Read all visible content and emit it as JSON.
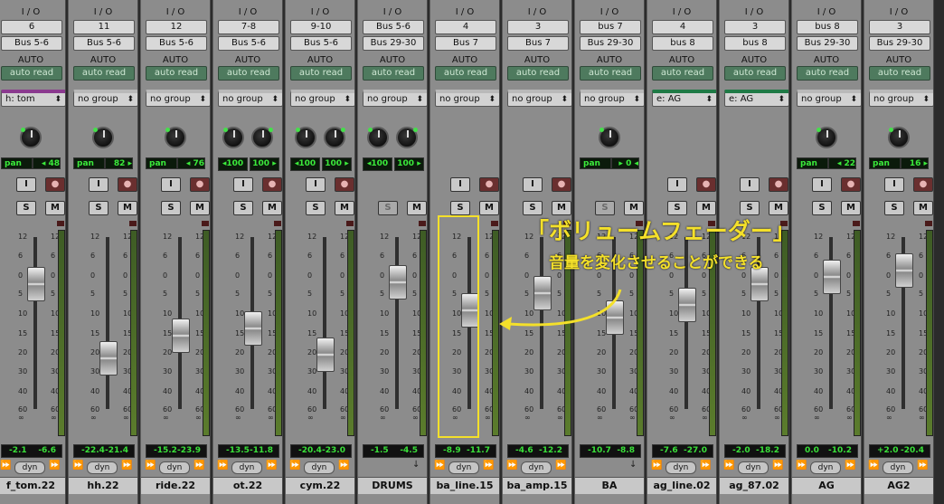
{
  "strips": [
    {
      "io": "I / O",
      "input": "6",
      "output": "Bus 5-6",
      "auto": "AUTO",
      "auto_mode": "auto read",
      "group": "h: tom",
      "group_color": "#8b3a8f",
      "knobs": 1,
      "pan": [
        "pan",
        "◂ 48"
      ],
      "vol": "-2.1",
      "peak": "-6.6",
      "name": "f_tom.22",
      "fader_db": -2.1
    },
    {
      "io": "I / O",
      "input": "11",
      "output": "Bus 5-6",
      "auto": "AUTO",
      "auto_mode": "auto read",
      "group": "no group",
      "group_color": "#b9b9b9",
      "knobs": 1,
      "pan": [
        "pan",
        "82 ▸"
      ],
      "vol": "-22.4",
      "peak": "-21.4",
      "name": "hh.22",
      "fader_db": -22.4
    },
    {
      "io": "I / O",
      "input": "12",
      "output": "Bus 5-6",
      "auto": "AUTO",
      "auto_mode": "auto read",
      "group": "no group",
      "group_color": "#b9b9b9",
      "knobs": 1,
      "pan": [
        "pan",
        "◂ 76"
      ],
      "vol": "-15.2",
      "peak": "-23.9",
      "name": "ride.22",
      "fader_db": -15.2
    },
    {
      "io": "I / O",
      "input": "7-8",
      "output": "Bus 5-6",
      "auto": "AUTO",
      "auto_mode": "auto read",
      "group": "no group",
      "group_color": "#b9b9b9",
      "knobs": 2,
      "pan": [
        "◂100",
        "100 ▸"
      ],
      "vol": "-13.5",
      "peak": "-11.8",
      "name": "ot.22",
      "fader_db": -13.5
    },
    {
      "io": "I / O",
      "input": "9-10",
      "output": "Bus 5-6",
      "auto": "AUTO",
      "auto_mode": "auto read",
      "group": "no group",
      "group_color": "#b9b9b9",
      "knobs": 2,
      "pan": [
        "◂100",
        "100 ▸"
      ],
      "vol": "-20.4",
      "peak": "-23.0",
      "name": "cym.22",
      "fader_db": -20.4
    },
    {
      "io": "I / O",
      "input": "Bus 5-6",
      "output": "Bus 29-30",
      "auto": "AUTO",
      "auto_mode": "auto read",
      "group": "no group",
      "group_color": "#b9b9b9",
      "knobs": 2,
      "pan": [
        "◂100",
        "100 ▸"
      ],
      "vol": "-1.5",
      "peak": "-4.5",
      "name": "DRUMS",
      "fader_db": -1.5,
      "aux": true
    },
    {
      "io": "I / O",
      "input": "4",
      "output": "Bus 7",
      "auto": "AUTO",
      "auto_mode": "auto read",
      "group": "no group",
      "group_color": "#b9b9b9",
      "knobs": 0,
      "pan": [],
      "vol": "-8.9",
      "peak": "-11.7",
      "name": "ba_line.15",
      "fader_db": -8.9
    },
    {
      "io": "I / O",
      "input": "3",
      "output": "Bus 7",
      "auto": "AUTO",
      "auto_mode": "auto read",
      "group": "no group",
      "group_color": "#b9b9b9",
      "knobs": 0,
      "pan": [],
      "vol": "-4.6",
      "peak": "-12.2",
      "name": "ba_amp.15",
      "fader_db": -4.6
    },
    {
      "io": "I / O",
      "input": "bus 7",
      "output": "Bus 29-30",
      "auto": "AUTO",
      "auto_mode": "auto read",
      "group": "no group",
      "group_color": "#b9b9b9",
      "knobs": 1,
      "pan": [
        "pan",
        "▸ 0 ◂"
      ],
      "vol": "-10.7",
      "peak": "-8.8",
      "name": "BA",
      "fader_db": -10.7,
      "aux": true
    },
    {
      "io": "I / O",
      "input": "4",
      "output": "bus 8",
      "auto": "AUTO",
      "auto_mode": "auto read",
      "group": "e: AG",
      "group_color": "#1f7a46",
      "knobs": 0,
      "pan": [],
      "vol": "-7.6",
      "peak": "-27.0",
      "name": "ag_line.02",
      "fader_db": -7.6
    },
    {
      "io": "I / O",
      "input": "3",
      "output": "bus 8",
      "auto": "AUTO",
      "auto_mode": "auto read",
      "group": "e: AG",
      "group_color": "#1f7a46",
      "knobs": 0,
      "pan": [],
      "vol": "-2.0",
      "peak": "-18.2",
      "name": "ag_87.02",
      "fader_db": -2.0
    },
    {
      "io": "I / O",
      "input": "bus 8",
      "output": "Bus 29-30",
      "auto": "AUTO",
      "auto_mode": "auto read",
      "group": "no group",
      "group_color": "#b9b9b9",
      "knobs": 1,
      "pan": [
        "pan",
        "◂ 22"
      ],
      "vol": "0.0",
      "peak": "-10.2",
      "name": "AG",
      "fader_db": 0.0
    },
    {
      "io": "I / O",
      "input": "3",
      "output": "Bus 29-30",
      "auto": "AUTO",
      "auto_mode": "auto read",
      "group": "no group",
      "group_color": "#b9b9b9",
      "knobs": 1,
      "pan": [
        "pan",
        "16 ▸"
      ],
      "vol": "+2.0",
      "peak": "-20.4",
      "name": "AG2",
      "fader_db": 2.0
    }
  ],
  "labels": {
    "input_btn": "I",
    "solo_btn": "S",
    "mute_btn": "M",
    "dyn": "dyn",
    "dyn_arrows": "⏩"
  },
  "scale_ticks": [
    "12",
    "6",
    "0",
    "5",
    "10",
    "15",
    "20",
    "30",
    "40",
    "60",
    "∞"
  ],
  "annotation": {
    "title": "「ボリュームフェーダー」",
    "subtitle": "音量を変化させることができる",
    "color": "#f4e02a"
  }
}
